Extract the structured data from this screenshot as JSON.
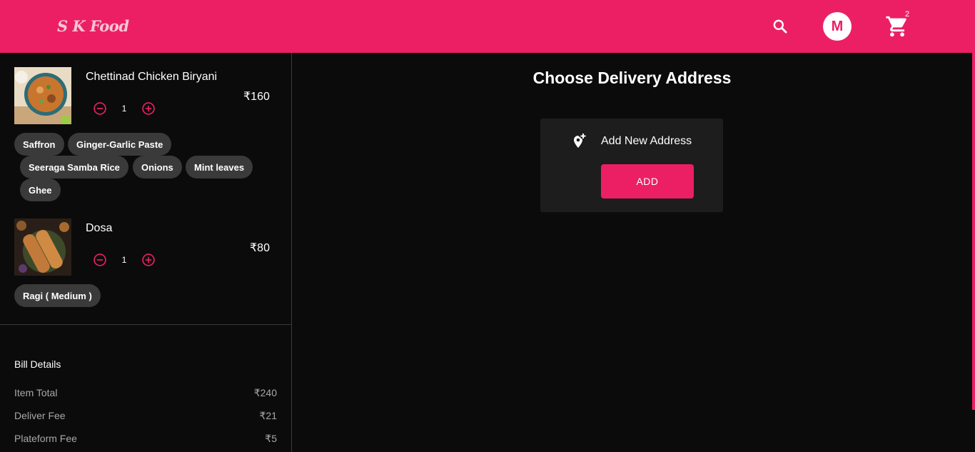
{
  "header": {
    "logo": "S K Food",
    "avatar_initial": "M",
    "cart_count": "2",
    "icons": {
      "search": "search-icon",
      "cart": "cart-icon"
    },
    "colors": {
      "brand": "#ec1f65"
    }
  },
  "cart": {
    "items": [
      {
        "name": "Chettinad Chicken Biryani",
        "price": "₹160",
        "quantity": "1",
        "addons": [
          "Saffron",
          "Ginger-Garlic Paste",
          "Seeraga Samba Rice",
          "Onions",
          "Mint leaves",
          "Ghee"
        ]
      },
      {
        "name": "Dosa",
        "price": "₹80",
        "quantity": "1",
        "addons": [
          "Ragi ( Medium )"
        ]
      }
    ]
  },
  "bill": {
    "title": "Bill Details",
    "rows": [
      {
        "label": "Item Total",
        "value": "₹240"
      },
      {
        "label": "Deliver Fee",
        "value": "₹21"
      },
      {
        "label": "Plateform Fee",
        "value": "₹5"
      }
    ]
  },
  "address": {
    "title": "Choose Delivery Address",
    "add_new_label": "Add New Address",
    "add_button": "ADD"
  }
}
